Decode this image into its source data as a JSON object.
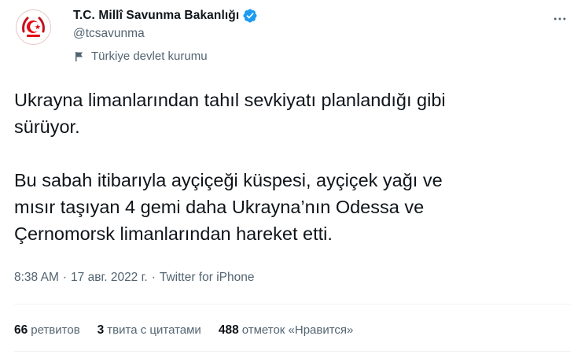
{
  "account": {
    "display_name": "T.C. Millî Savunma Bakanlığı",
    "handle": "@tcsavunma",
    "label": "Türkiye devlet kurumu",
    "verified_icon": "verified-badge-icon",
    "brand_color": "#e30a17",
    "accent_color": "#1d9bf0"
  },
  "tweet": {
    "text": "Ukrayna limanlarından tahıl sevkiyatı planlandığı gibi\nsürüyor.\n\nBu sabah itibarıyla ayçiçeği küspesi, ayçiçek yağı ve\nmısır taşıyan 4 gemi daha Ukrayna’nın Odessa ve\nÇernomorsk limanlarından hareket etti.",
    "time": "8:38 AM",
    "separator": "·",
    "date": "17 авг. 2022 г.",
    "source": "Twitter for iPhone"
  },
  "stats": [
    {
      "count": "66",
      "label": "ретвитов"
    },
    {
      "count": "3",
      "label": "твита с цитатами"
    },
    {
      "count": "488",
      "label": "отметок «Нравится»"
    }
  ],
  "icons": {
    "more": "more-icon",
    "flag": "flag-icon"
  }
}
